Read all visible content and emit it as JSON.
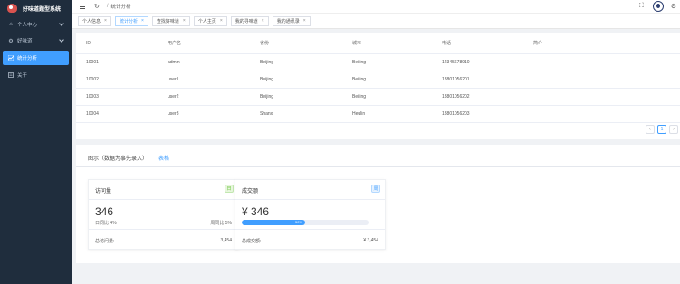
{
  "app": {
    "title": "好味道题型系统"
  },
  "sidebar": {
    "items": [
      {
        "label": "个人中心",
        "icon": "home-icon",
        "expandable": true
      },
      {
        "label": "好味道",
        "icon": "gear-icon",
        "expandable": true
      },
      {
        "label": "统计分析",
        "icon": "chart-icon",
        "active": true
      },
      {
        "label": "关于",
        "icon": "document-icon"
      }
    ]
  },
  "header": {
    "breadcrumb": "统计分析"
  },
  "tags": [
    {
      "label": "个人信息",
      "active": false
    },
    {
      "label": "统计分析",
      "active": true
    },
    {
      "label": "查找好味道",
      "active": false
    },
    {
      "label": "个人主页",
      "active": false
    },
    {
      "label": "我的寻味道",
      "active": false
    },
    {
      "label": "我的通讯录",
      "active": false
    }
  ],
  "table": {
    "columns": [
      "ID",
      "用户名",
      "省份",
      "城市",
      "电话",
      "简介"
    ],
    "rows": [
      [
        "10001",
        "admin",
        "Beijing",
        "Beijing",
        "12345678910",
        ""
      ],
      [
        "10002",
        "user1",
        "Beijing",
        "Beijing",
        "18801056201",
        ""
      ],
      [
        "10003",
        "user2",
        "Beijing",
        "Beijing",
        "18801056202",
        ""
      ],
      [
        "10004",
        "user3",
        "Shanxi",
        "Heulin",
        "18801056203",
        ""
      ]
    ]
  },
  "pagination": {
    "current_page": "1"
  },
  "bottom": {
    "tabs": [
      {
        "label": "图示（数据为事先录入）",
        "active": false
      },
      {
        "label": "表格",
        "active": true
      }
    ],
    "card1": {
      "title": "访问量",
      "badge": "日",
      "value": "346",
      "day_ratio": "日同比 4%",
      "week_ratio": "周同比 5%",
      "total_label": "总访问量:",
      "total_value": "3,454"
    },
    "card2": {
      "title": "成交额",
      "badge": "周",
      "value": "¥ 346",
      "progress": 0.5,
      "progress_label": "50%",
      "total_label": "总成交额:",
      "total_value": "¥ 3,454"
    }
  },
  "colors": {
    "sidebar_bg": "#1f2d3d",
    "accent": "#409eff"
  }
}
